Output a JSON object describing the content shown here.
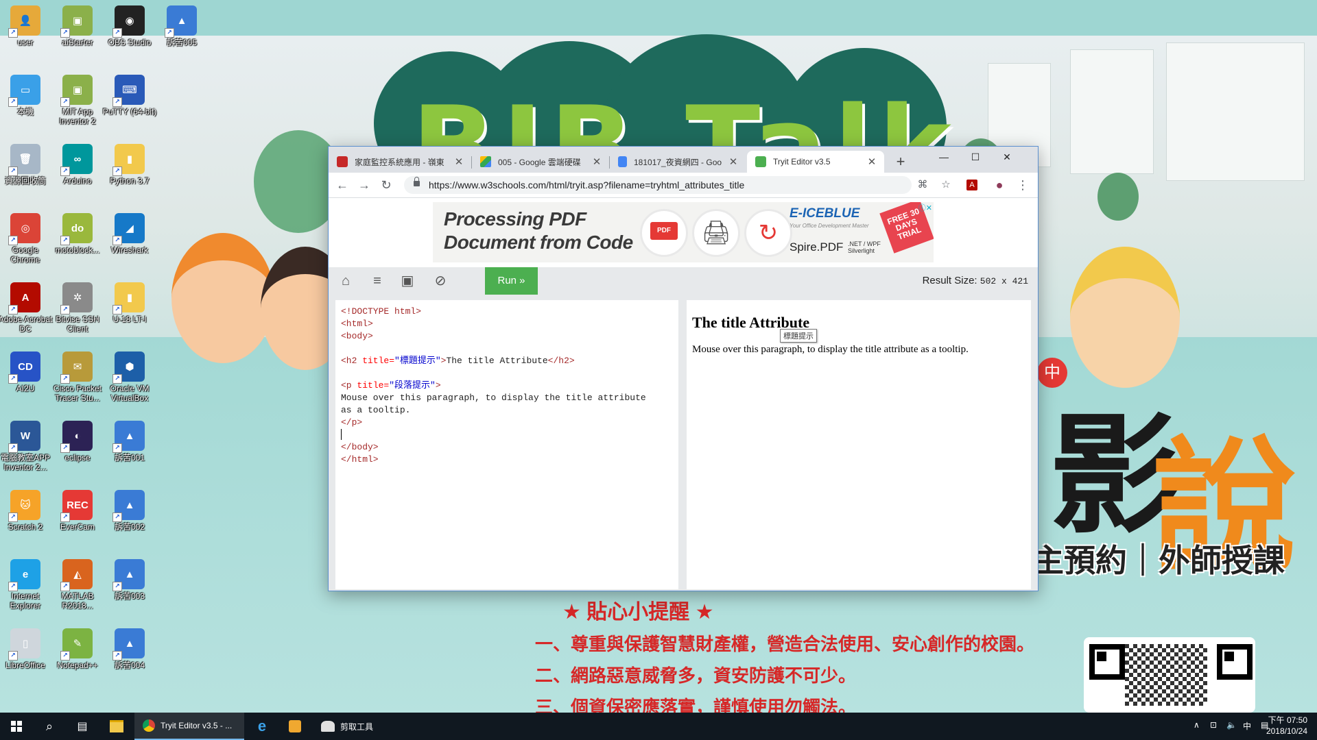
{
  "desktop": {
    "icons": [
      {
        "label": "user",
        "glyph": "👤",
        "color": "#e6a93a",
        "icon": "user-folder-icon"
      },
      {
        "label": "aiStarter",
        "glyph": "▣",
        "color": "#8bb04a",
        "icon": "android-icon"
      },
      {
        "label": "OBS Studio",
        "glyph": "◉",
        "color": "#222222",
        "icon": "obs-icon"
      },
      {
        "label": "訴苦005",
        "glyph": "▲",
        "color": "#3a7bd5",
        "icon": "image-file-icon"
      },
      {
        "label": "本機",
        "glyph": "▭",
        "color": "#3aa0e8",
        "icon": "computer-icon"
      },
      {
        "label": "MIT App Inventor 2",
        "glyph": "▣",
        "color": "#8bb04a",
        "icon": "android-icon"
      },
      {
        "label": "PuTTY (64-bit)",
        "glyph": "⌨",
        "color": "#2a5ab8",
        "icon": "putty-icon"
      },
      {
        "label": "資源回收筒",
        "glyph": "🗑",
        "color": "#a7b7c7",
        "icon": "recycle-bin-icon"
      },
      {
        "label": "Arduino",
        "glyph": "∞",
        "color": "#00979c",
        "icon": "arduino-icon"
      },
      {
        "label": "Python 3.7",
        "glyph": "▮",
        "color": "#f2c94c",
        "icon": "folder-icon"
      },
      {
        "label": "Google Chrome",
        "glyph": "◎",
        "color": "#db4437",
        "icon": "chrome-icon"
      },
      {
        "label": "motoblock...",
        "glyph": "do",
        "color": "#9ab83c",
        "icon": "motoblock-icon"
      },
      {
        "label": "Wireshark",
        "glyph": "◢",
        "color": "#1679c8",
        "icon": "wireshark-icon"
      },
      {
        "label": "Adobe Acrobat DC",
        "glyph": "A",
        "color": "#b30b00",
        "icon": "acrobat-icon"
      },
      {
        "label": "Bitvise SSH Client",
        "glyph": "✲",
        "color": "#8a8a8a",
        "icon": "bitvise-icon"
      },
      {
        "label": "U-18 LT-I",
        "glyph": "▮",
        "color": "#f2c94c",
        "icon": "folder-icon"
      },
      {
        "label": "AI2U",
        "glyph": "CD",
        "color": "#2753c6",
        "icon": "ai2u-icon"
      },
      {
        "label": "Cisco Packet Tracer Stu...",
        "glyph": "✉",
        "color": "#b89a3a",
        "icon": "packet-tracer-icon"
      },
      {
        "label": "Oracle VM VirtualBox",
        "glyph": "⬢",
        "color": "#1d5fa8",
        "icon": "virtualbox-icon"
      },
      {
        "label": "電腦教室APP Inventor 2...",
        "glyph": "W",
        "color": "#2b5797",
        "icon": "word-doc-icon"
      },
      {
        "label": "eclipse",
        "glyph": "◐",
        "color": "#2c2255",
        "icon": "eclipse-icon"
      },
      {
        "label": "訴苦001",
        "glyph": "▲",
        "color": "#3a7bd5",
        "icon": "image-file-icon"
      },
      {
        "label": "Scratch 2",
        "glyph": "🐱",
        "color": "#f6a328",
        "icon": "scratch-icon"
      },
      {
        "label": "EverCam",
        "glyph": "REC",
        "color": "#e53935",
        "icon": "evercam-icon"
      },
      {
        "label": "訴苦002",
        "glyph": "▲",
        "color": "#3a7bd5",
        "icon": "image-file-icon"
      },
      {
        "label": "Internet Explorer",
        "glyph": "e",
        "color": "#1ea1e6",
        "icon": "internet-explorer-icon"
      },
      {
        "label": "MATLAB R2018...",
        "glyph": "◭",
        "color": "#d9641e",
        "icon": "matlab-icon"
      },
      {
        "label": "訴苦003",
        "glyph": "▲",
        "color": "#3a7bd5",
        "icon": "image-file-icon"
      },
      {
        "label": "LibreOffice",
        "glyph": "▯",
        "color": "#cfd6dc",
        "icon": "libreoffice-icon"
      },
      {
        "label": "Notepad++",
        "glyph": "✎",
        "color": "#7cb342",
        "icon": "notepadpp-icon"
      },
      {
        "label": "訴苦004",
        "glyph": "▲",
        "color": "#3a7bd5",
        "icon": "image-file-icon"
      }
    ]
  },
  "wallpaper": {
    "logo_text": "BIB Talk",
    "big_chars": [
      "影",
      "說",
      "中"
    ],
    "slogan": "主預約｜外師授課",
    "tips_title": "★ 貼心小提醒 ★",
    "tips": [
      "一、尊重與保護智慧財產權，營造合法使用、安心創作的校園。",
      "二、網路惡意威脅多，資安防護不可少。",
      "三、個資保密應落實，謹慎使用勿觸法。"
    ]
  },
  "browser": {
    "tabs": [
      {
        "title": "家庭監控系統應用 - 嶺東",
        "favicon_color": "#c62828",
        "active": false
      },
      {
        "title": "005 - Google 雲端硬碟",
        "favicon_color": "#fbbc04",
        "active": false
      },
      {
        "title": "181017_夜資網四 - Goo",
        "favicon_color": "#4285f4",
        "active": false
      },
      {
        "title": "Tryit Editor v3.5",
        "favicon_color": "#4caf50",
        "active": true
      }
    ],
    "new_tab": "+",
    "window_controls": {
      "minimize": "—",
      "maximize": "☐",
      "close": "✕"
    },
    "nav": {
      "back": "←",
      "forward": "→",
      "reload": "↻"
    },
    "url": "https://www.w3schools.com/html/tryit.asp?filename=tryhtml_attributes_title",
    "toolbar_icons": {
      "translate": "⌘",
      "star": "☆",
      "acrobat": "A",
      "profile": "●",
      "menu": "⋮"
    }
  },
  "ad": {
    "headline_line1": "Processing PDF",
    "headline_line2": "Document from Code",
    "circle_labels": [
      "PDF",
      "🖨",
      "↻"
    ],
    "brand": "E-ICEBLUE",
    "brand_sub": "Your Office Development Master",
    "product": "Spire.PDF",
    "platforms": ".NET / WPF\nSilverlight",
    "free_badge": "FREE 30 DAYS TRIAL",
    "close": "ⓘ✕"
  },
  "editor": {
    "run_label": "Run »",
    "result_size_label": "Result Size:",
    "result_size_value": "502 x 421",
    "icons": {
      "home": "⌂",
      "menu": "≡",
      "save": "▣",
      "rotate": "⊘"
    }
  },
  "code": {
    "l1": "<!DOCTYPE html>",
    "l2": "<html>",
    "l3": "<body>",
    "h2_open": "<h2",
    "h2_attr": " title=",
    "h2_val": "\"標題提示\"",
    "h2_close": ">",
    "h2_text": "The title Attribute",
    "h2_end": "</h2>",
    "p_open": "<p",
    "p_attr": " title=",
    "p_val": "\"段落提示\"",
    "p_close": ">",
    "p_text1": "Mouse over this paragraph, to display the title attribute",
    "p_text2": "as a tooltip.",
    "p_end": "</p>",
    "body_end": "</body>",
    "html_end": "</html>"
  },
  "result": {
    "heading": "The title Attribute",
    "paragraph": "Mouse over this paragraph, to display the title attribute as a tooltip.",
    "tooltip": "標題提示"
  },
  "taskbar": {
    "items": [
      {
        "label": "",
        "icon": "windows-start-icon"
      },
      {
        "label": "",
        "icon": "search-icon"
      },
      {
        "label": "",
        "icon": "task-view-icon"
      },
      {
        "label": "",
        "icon": "file-explorer-icon"
      },
      {
        "label": "Tryit Editor v3.5 - ...",
        "icon": "chrome-icon"
      },
      {
        "label": "",
        "icon": "internet-explorer-icon"
      },
      {
        "label": "",
        "icon": "media-player-icon"
      },
      {
        "label": "剪取工具",
        "icon": "snipping-tool-icon"
      }
    ],
    "tray": {
      "chevron": "∧",
      "network": "⊡",
      "volume": "🔈",
      "ime": "中",
      "notify": "▤"
    },
    "time": "下午 07:50",
    "date": "2018/10/24"
  }
}
